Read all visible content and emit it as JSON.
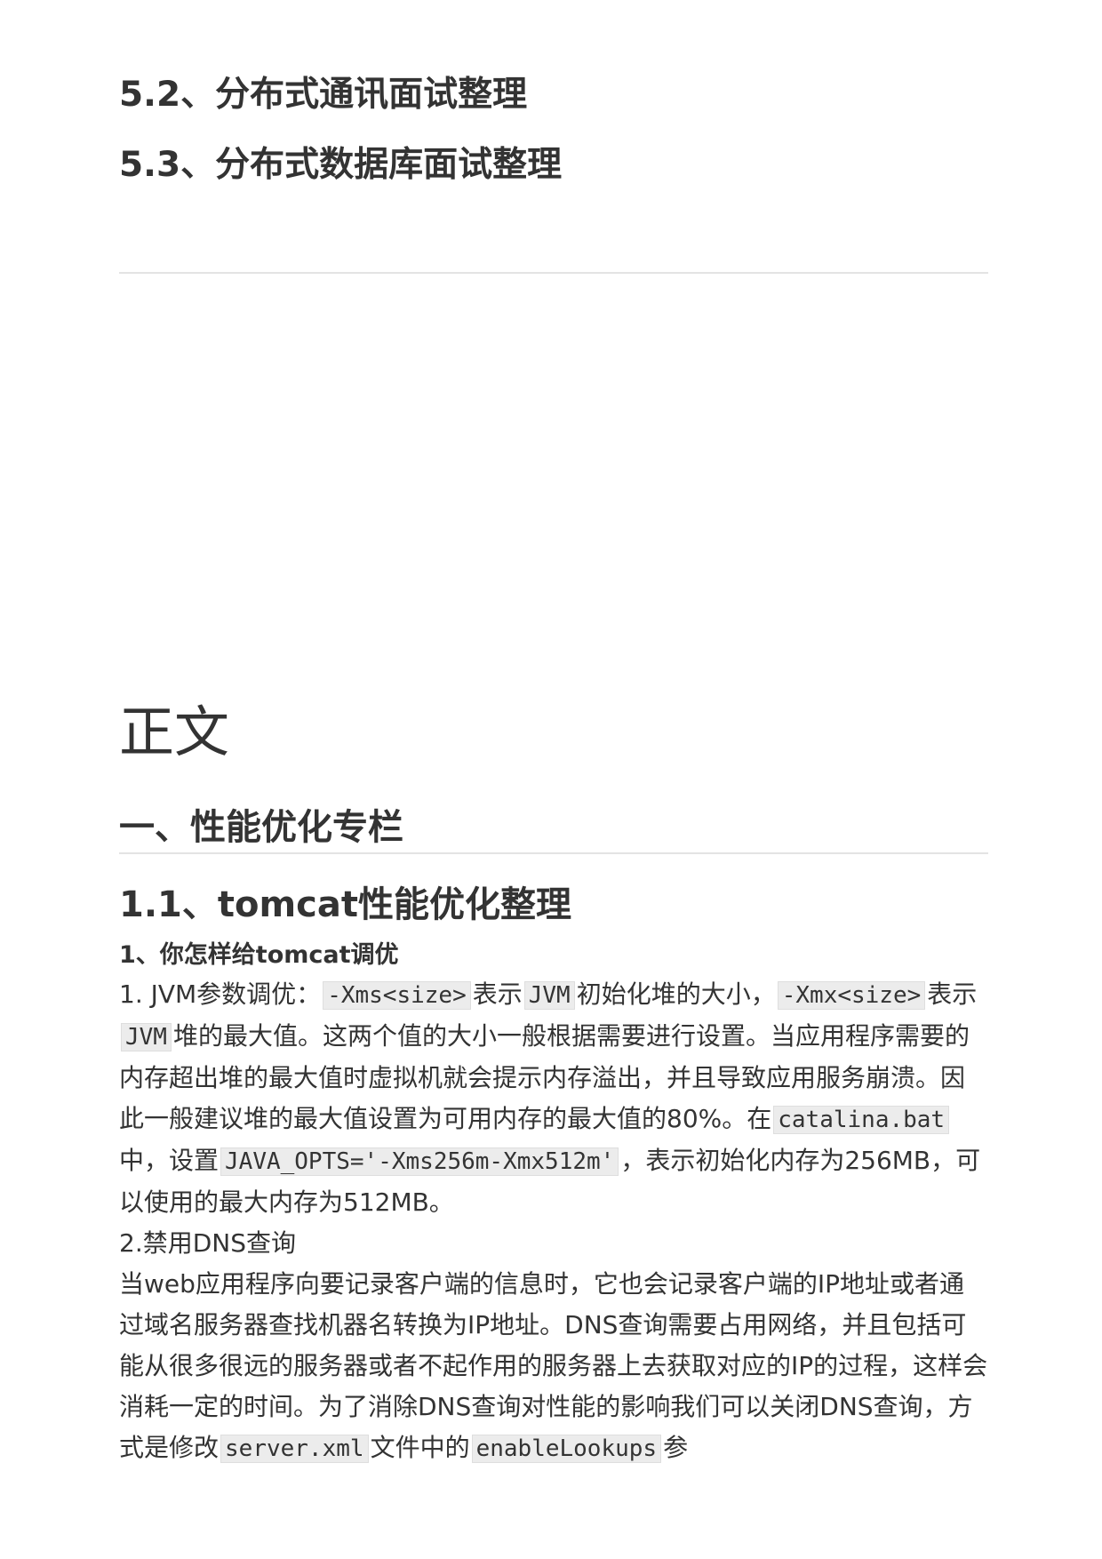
{
  "sections": {
    "h_5_2": "5.2、分布式通讯面试整理",
    "h_5_3": "5.3、分布式数据库面试整理"
  },
  "main": {
    "title": "正文",
    "chapter": "一、性能优化专栏",
    "section": "1.1、tomcat性能优化整理",
    "question": "1、你怎样给tomcat调优"
  },
  "content": {
    "p1_a": "1. JVM参数调优：",
    "p1_code1": "-Xms<size>",
    "p1_b": "表示",
    "p1_code2": "JVM",
    "p1_c": "初始化堆的大小，",
    "p1_code3": "-Xmx<size>",
    "p1_d": "表示",
    "p1_code4": "JVM",
    "p1_e": "堆的最大值。这两个值的大小一般根据需要进行设置。当应用程序需要的内存超出堆的最大值时虚拟机就会提示内存溢出，并且导致应用服务崩溃。因此一般建议堆的最大值设置为可用内存的最大值的80%。在",
    "p1_code5": "catalina.bat",
    "p1_f": "中，设置",
    "p1_code6": "JAVA_OPTS='-Xms256m-Xmx512m'",
    "p1_g": "，表示初始化内存为256MB，可以使用的最大内存为512MB。",
    "p2_title": "2.禁用DNS查询",
    "p3_a": "当web应用程序向要记录客户端的信息时，它也会记录客户端的IP地址或者通过域名服务器查找机器名转换为IP地址。DNS查询需要占用网络，并且包括可能从很多很远的服务器或者不起作用的服务器上去获取对应的IP的过程，这样会消耗一定的时间。为了消除DNS查询对性能的影响我们可以关闭DNS查询，方式是修改",
    "p3_code1": "server.xml",
    "p3_b": "文件中的",
    "p3_code2": "enableLookups",
    "p3_c": "参"
  }
}
